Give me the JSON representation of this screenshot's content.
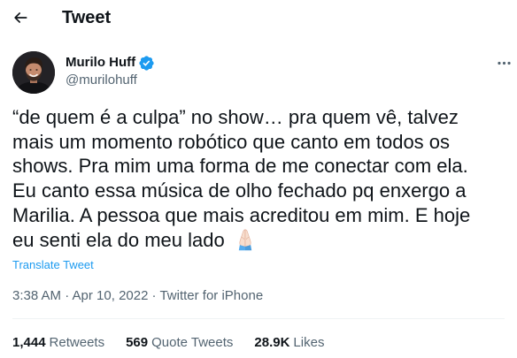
{
  "header": {
    "title": "Tweet",
    "back_icon": "back-arrow-icon"
  },
  "tweet": {
    "author": {
      "name": "Murilo Huff",
      "handle": "@murilohuff",
      "verified_icon": "verified-badge-icon"
    },
    "more_icon": "more-dots-icon",
    "text_lines": [
      "“de quem é a culpa” no show… pra quem vê, talvez",
      "mais um momento robótico que canto em todos os",
      "shows. Pra mim uma forma de me conectar com ela.",
      "Eu canto essa música de olho fechado pq enxergo a",
      "Marilia. A pessoa que mais acreditou em mim. E hoje",
      "eu senti ela do meu lado"
    ],
    "emoji": "🙏🏻",
    "translate_label": "Translate Tweet",
    "timestamp": "3:38 AM · Apr 10, 2022",
    "separator": "·",
    "source": "Twitter for iPhone",
    "stats": [
      {
        "count": "1,444",
        "label": "Retweets"
      },
      {
        "count": "569",
        "label": "Quote Tweets"
      },
      {
        "count": "28.9K",
        "label": "Likes"
      }
    ]
  },
  "colors": {
    "text": "#0F1419",
    "secondary": "#536471",
    "accent": "#1D9BF0",
    "border": "#EFF3F4"
  }
}
